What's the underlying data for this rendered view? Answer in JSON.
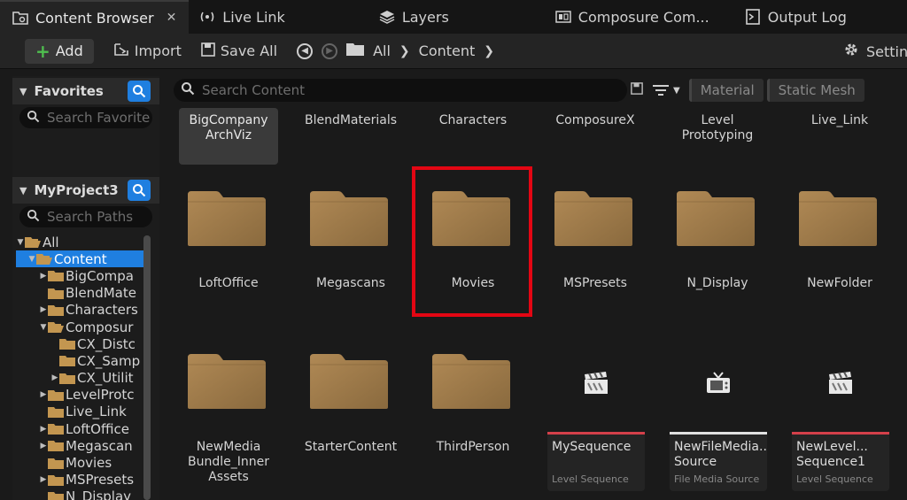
{
  "tabs": [
    {
      "label": "Content Browser",
      "active": true,
      "icon": "content-browser-icon"
    },
    {
      "label": "Live Link",
      "icon": "live-link-icon"
    },
    {
      "label": "Layers",
      "icon": "layers-icon"
    },
    {
      "label": "Composure Com...",
      "icon": "composure-icon"
    },
    {
      "label": "Output Log",
      "icon": "output-log-icon"
    }
  ],
  "toolbar": {
    "add_label": "Add",
    "import_label": "Import",
    "save_all_label": "Save All",
    "breadcrumb": [
      "All",
      "Content"
    ],
    "settings_label": "Settings"
  },
  "favorites": {
    "title": "Favorites",
    "search_placeholder": "Search Favorite"
  },
  "project": {
    "title": "MyProject3",
    "search_placeholder": "Search Paths"
  },
  "tree": [
    {
      "label": "All",
      "indent": 0,
      "expanded": true
    },
    {
      "label": "Content",
      "indent": 1,
      "expanded": true,
      "selected": true
    },
    {
      "label": "BigCompa",
      "indent": 2,
      "collapsed": true
    },
    {
      "label": "BlendMate",
      "indent": 2
    },
    {
      "label": "Characters",
      "indent": 2,
      "collapsed": true
    },
    {
      "label": "Composur",
      "indent": 2,
      "expanded": true
    },
    {
      "label": "CX_Distc",
      "indent": 3
    },
    {
      "label": "CX_Samp",
      "indent": 3
    },
    {
      "label": "CX_Utilit",
      "indent": 3,
      "collapsed": true
    },
    {
      "label": "LevelProtc",
      "indent": 2,
      "collapsed": true
    },
    {
      "label": "Live_Link",
      "indent": 2
    },
    {
      "label": "LoftOffice",
      "indent": 2,
      "collapsed": true
    },
    {
      "label": "Megascan",
      "indent": 2,
      "collapsed": true
    },
    {
      "label": "Movies",
      "indent": 2
    },
    {
      "label": "MSPresets",
      "indent": 2,
      "collapsed": true
    },
    {
      "label": "N_Display",
      "indent": 2
    }
  ],
  "content": {
    "search_placeholder": "Search Content",
    "filters": [
      "Material",
      "Static Mesh"
    ],
    "row1": [
      "BigCompany\nArchViz",
      "BlendMaterials",
      "Characters",
      "ComposureX",
      "Level\nPrototyping",
      "Live_Link"
    ],
    "row2": [
      "LoftOffice",
      "Megascans",
      "Movies",
      "MSPresets",
      "N_Display",
      "NewFolder"
    ],
    "row3_folders": [
      "NewMedia\nBundle_Inner\nAssets",
      "StarterContent",
      "ThirdPerson"
    ],
    "assets": [
      {
        "name": "MySequence",
        "type": "Level Sequence",
        "icon": "clapperboard-icon"
      },
      {
        "name": "NewFileMedia...\nSource",
        "type": "File Media Source",
        "icon": "tv-icon"
      },
      {
        "name": "NewLevel...\nSequence1",
        "type": "Level Sequence",
        "icon": "clapperboard-icon"
      }
    ]
  },
  "colors": {
    "accent": "#1f7fe0",
    "folder": "#a8834f",
    "highlight": "#e30613",
    "asset_bar": "#d4404a"
  }
}
